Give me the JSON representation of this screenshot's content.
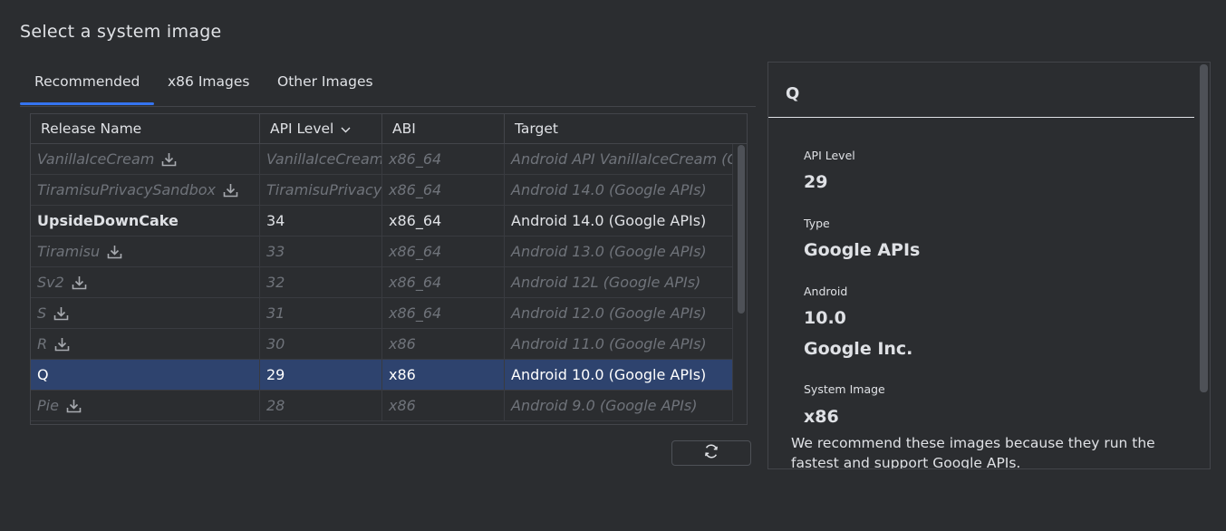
{
  "title": "Select a system image",
  "tabs": [
    {
      "label": "Recommended",
      "active": true
    },
    {
      "label": "x86 Images",
      "active": false
    },
    {
      "label": "Other Images",
      "active": false
    }
  ],
  "table": {
    "headers": [
      "Release Name",
      "API Level",
      "ABI",
      "Target"
    ],
    "sort_icon": "chevron-down-icon",
    "rows": [
      {
        "name": "VanillaIceCream",
        "api": "VanillaIceCream",
        "abi": "x86_64",
        "target": "Android API VanillaIceCream (Google APIs)",
        "download": true,
        "state": "disabled"
      },
      {
        "name": "TiramisuPrivacySandbox",
        "api": "TiramisuPrivacySandbox",
        "abi": "x86_64",
        "target": "Android 14.0 (Google APIs)",
        "download": true,
        "state": "disabled"
      },
      {
        "name": "UpsideDownCake",
        "api": "34",
        "abi": "x86_64",
        "target": "Android 14.0 (Google APIs)",
        "download": false,
        "state": "installed"
      },
      {
        "name": "Tiramisu",
        "api": "33",
        "abi": "x86_64",
        "target": "Android 13.0 (Google APIs)",
        "download": true,
        "state": "disabled"
      },
      {
        "name": "Sv2",
        "api": "32",
        "abi": "x86_64",
        "target": "Android 12L (Google APIs)",
        "download": true,
        "state": "disabled"
      },
      {
        "name": "S",
        "api": "31",
        "abi": "x86_64",
        "target": "Android 12.0 (Google APIs)",
        "download": true,
        "state": "disabled"
      },
      {
        "name": "R",
        "api": "30",
        "abi": "x86",
        "target": "Android 11.0 (Google APIs)",
        "download": true,
        "state": "disabled"
      },
      {
        "name": "Q",
        "api": "29",
        "abi": "x86",
        "target": "Android 10.0 (Google APIs)",
        "download": false,
        "state": "selected"
      },
      {
        "name": "Pie",
        "api": "28",
        "abi": "x86",
        "target": "Android 9.0 (Google APIs)",
        "download": true,
        "state": "disabled"
      }
    ]
  },
  "refresh_icon": "refresh-icon",
  "detail": {
    "title": "Q",
    "api_level_label": "API Level",
    "api_level": "29",
    "type_label": "Type",
    "type": "Google APIs",
    "android_label": "Android",
    "android_version": "10.0",
    "vendor": "Google Inc.",
    "system_image_label": "System Image",
    "system_image": "x86",
    "note": "We recommend these images because they run the fastest and support Google APIs."
  },
  "colors": {
    "background": "#2b2d30",
    "accent": "#3574f0",
    "selected_row": "#2e436e",
    "disabled_text": "#6f737a",
    "text": "#dfe1e5"
  }
}
